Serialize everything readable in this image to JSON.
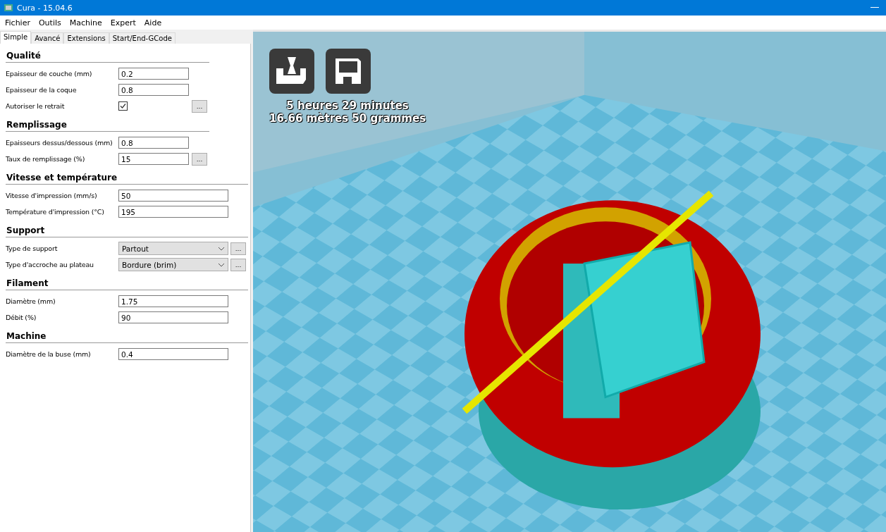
{
  "window": {
    "title": "Cura - 15.04.6"
  },
  "menu": [
    "Fichier",
    "Outils",
    "Machine",
    "Expert",
    "Aide"
  ],
  "tabs": [
    {
      "label": "Simple",
      "selected": true
    },
    {
      "label": "Avancé",
      "selected": false
    },
    {
      "label": "Extensions",
      "selected": false
    },
    {
      "label": "Start/End-GCode",
      "selected": false
    }
  ],
  "sections": [
    {
      "title": "Qualité",
      "rows": [
        {
          "kind": "text",
          "label": "Epaisseur de couche (mm)",
          "value": "0.2"
        },
        {
          "kind": "text",
          "label": "Epaisseur de la coque",
          "value": "0.8"
        },
        {
          "kind": "checkbox",
          "label": "Autoriser le retrait",
          "checked": true,
          "more": "..."
        }
      ]
    },
    {
      "title": "Remplissage",
      "rows": [
        {
          "kind": "text",
          "label": "Epaisseurs dessus/dessous (mm)",
          "value": "0.8"
        },
        {
          "kind": "text",
          "label": "Taux de remplissage (%)",
          "value": "15",
          "more": "..."
        }
      ]
    },
    {
      "title": "Vitesse et température",
      "rows": [
        {
          "kind": "text",
          "label": "Vitesse d'impression (mm/s)",
          "value": "50"
        },
        {
          "kind": "text",
          "label": "Température d'impression (°C)",
          "value": "195"
        }
      ]
    },
    {
      "title": "Support",
      "rows": [
        {
          "kind": "select",
          "label": "Type de support",
          "value": "Partout",
          "more": "..."
        },
        {
          "kind": "select",
          "label": "Type d'accroche au plateau",
          "value": "Bordure (brim)",
          "more": "..."
        }
      ]
    },
    {
      "title": "Filament",
      "rows": [
        {
          "kind": "text",
          "label": "Diamètre (mm)",
          "value": "1.75"
        },
        {
          "kind": "text",
          "label": "Débit (%)",
          "value": "90"
        }
      ]
    },
    {
      "title": "Machine",
      "rows": [
        {
          "kind": "text",
          "label": "Diamètre de la buse (mm)",
          "value": "0.4"
        }
      ]
    }
  ],
  "viewport": {
    "estimate": [
      "5 heures 29 minutes",
      "16.66 mètres 50 grammes"
    ]
  }
}
